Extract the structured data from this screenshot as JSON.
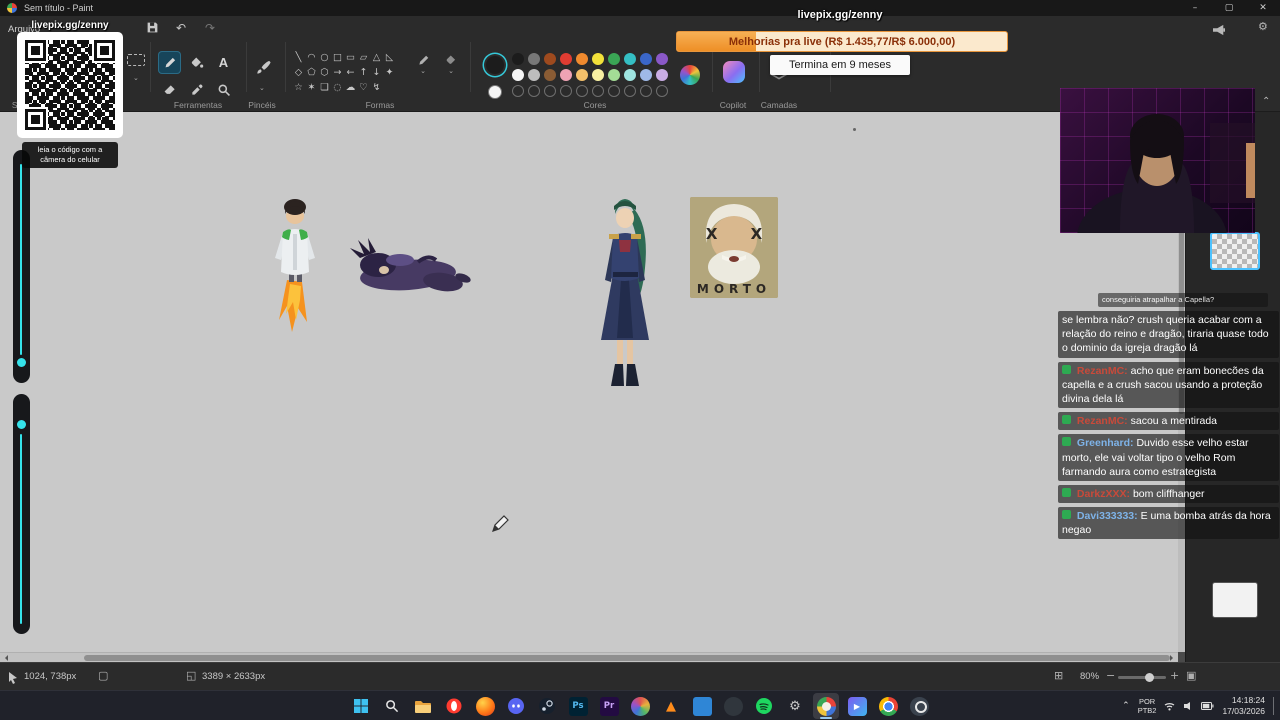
{
  "window": {
    "title": "Sem título - Paint",
    "minimize": "–",
    "maximize": "▢",
    "close": "✕"
  },
  "menu": {
    "file": "Arquivo"
  },
  "quick": {
    "undo": "↶",
    "redo": "↷"
  },
  "ui": {
    "caret": "⌄",
    "collapse": "⌃",
    "settings_gear": "⚙",
    "tray_chevron": "⌃"
  },
  "ribbon": {
    "labels": {
      "select": "Selecionar",
      "tools": "Ferramentas",
      "brushes": "Pincéis",
      "shapes": "Formas",
      "colors": "Cores",
      "copilot": "Copilot",
      "layers": "Camadas"
    },
    "text_tool_glyph": "A",
    "shape_glyphs": [
      "╲",
      "◠",
      "○",
      "□",
      "▭",
      "▱",
      "△",
      "◺",
      "◇",
      "⬠",
      "⬡",
      "→",
      "←",
      "↑",
      "↓",
      "✦",
      "☆",
      "✶",
      "❏",
      "◌",
      "☁",
      "♡",
      "↯"
    ],
    "color1": "#1c1c1c",
    "color2": "#f5f5f5",
    "palette_row1": [
      "#1c1c1c",
      "#787878",
      "#9e4a1e",
      "#e03c32",
      "#f08a2e",
      "#f2e13a",
      "#3aa655",
      "#35bfc4",
      "#3a66c8",
      "#8a58c8"
    ],
    "palette_row2": [
      "#f5f5f5",
      "#bdbdbd",
      "#8a5c34",
      "#efa3b4",
      "#f3c06a",
      "#f7f0a2",
      "#a4dc96",
      "#9fe4e0",
      "#9fb9e8",
      "#c9ade4"
    ]
  },
  "overlay": {
    "qr_title": "livepix.gg/zenny",
    "qr_caption": "leia o código com a câmera do celular",
    "donation_url": "livepix.gg/zenny",
    "donation_goal": "Melhorias pra live (R$ 1.435,77/R$ 6.000,00)",
    "donation_deadline": "Termina em 9 meses",
    "donation_progress_pct": 24
  },
  "canvas": {
    "portrait_eyes": "X X",
    "portrait_caption": "MORTO"
  },
  "chat": {
    "messages": [
      {
        "user": "",
        "color": "",
        "text": "conseguiria atrapalhar a Capella?"
      },
      {
        "user": "",
        "color": "",
        "text": "se lembra não? crush queria acabar com a relação do reino e dragão, tiraria quase todo o dominio da igreja dragão lá"
      },
      {
        "user": "RezanMC:",
        "color": "#c84a3a",
        "text": "acho que eram bonecões da capella e a crush sacou usando a proteção divina dela lá"
      },
      {
        "user": "RezanMC:",
        "color": "#c84a3a",
        "text": "sacou a mentirada"
      },
      {
        "user": "Greenhard:",
        "color": "#7eb3e8",
        "text": "Duvido esse velho estar morto, ele vai voltar tipo o velho Rom farmando aura como estrategista"
      },
      {
        "user": "DarkzXXX:",
        "color": "#c84a3a",
        "text": "bom cliffhanger"
      },
      {
        "user": "Davi333333:",
        "color": "#7eb3e8",
        "text": "E uma bomba atrás da hora negao"
      }
    ]
  },
  "status_bar": {
    "cursor_pos": "1024, 738px",
    "image_size": "3389 × 2633px",
    "zoom": "80%",
    "icons": {
      "selection": "▢",
      "size": "◱",
      "grid": "⊞",
      "zoom_out": "−",
      "zoom_in": "+",
      "fit": "▣"
    }
  },
  "taskbar": {
    "apps": [
      {
        "name": "start",
        "glyph": ""
      },
      {
        "name": "search",
        "glyph": ""
      },
      {
        "name": "file-explorer",
        "glyph": ""
      },
      {
        "name": "opera",
        "glyph": ""
      },
      {
        "name": "firefox",
        "glyph": ""
      },
      {
        "name": "discord",
        "glyph": ""
      },
      {
        "name": "steam",
        "glyph": ""
      },
      {
        "name": "photoshop",
        "glyph": "Ps"
      },
      {
        "name": "premiere",
        "glyph": "Pr"
      },
      {
        "name": "color-app",
        "glyph": ""
      },
      {
        "name": "vlc",
        "glyph": "▲"
      },
      {
        "name": "vscode",
        "glyph": ""
      },
      {
        "name": "github",
        "glyph": ""
      },
      {
        "name": "spotify",
        "glyph": ""
      },
      {
        "name": "settings",
        "glyph": "⚙"
      },
      {
        "name": "paint",
        "glyph": ""
      },
      {
        "name": "media",
        "glyph": "▶"
      },
      {
        "name": "chrome",
        "glyph": ""
      },
      {
        "name": "obs",
        "glyph": ""
      }
    ],
    "language_line1": "POR",
    "language_line2": "PTB2",
    "time": "14:18:24",
    "date": "17/03/2026"
  }
}
